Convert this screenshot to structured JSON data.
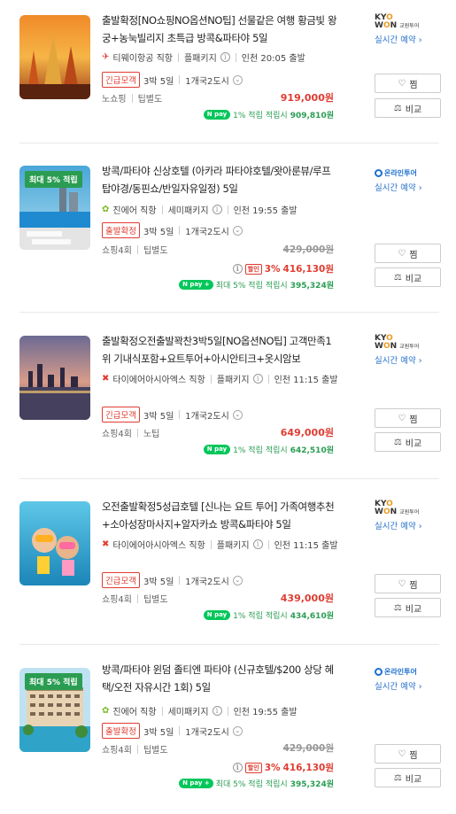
{
  "labels": {
    "wish": "찜",
    "compare": "비교",
    "realtime": "실시간 예약 ›",
    "reward_prefix": "적립시"
  },
  "products": [
    {
      "title": "출발확정[NO쇼핑NO옵션NO팁] 선물같은 여행 황금빛 왕궁+농눅빌리지 초특급 방콕&파타야 5일",
      "badge": "",
      "airline": "티웨이항공 직항",
      "airline_icon": "airplane-icon",
      "package": "플패키지",
      "departure": "인천 20:05 출발",
      "status_tag": "긴급모객",
      "duration": "3박 5일",
      "countries": "1개국2도시",
      "shopping": "노쇼핑",
      "tip": "팁별도",
      "original_price": "",
      "discount_rate": "",
      "discount_label": "",
      "price": "919,000원",
      "reward_rate": "1% 적립",
      "reward_amount": "909,810원",
      "agency": "KYOWON 교원투어"
    },
    {
      "title": "방콕/파타야 신상호텔 (아카라 파타야호텔/왓아룬뷰/루프탑야경/동핀쇼/반일자유일정) 5일",
      "badge": "최대 5% 적립",
      "airline": "진에어 직항",
      "airline_icon": "airplane-icon",
      "package": "세미패키지",
      "departure": "인천 19:55 출발",
      "status_tag": "출발확정",
      "duration": "3박 5일",
      "countries": "1개국2도시",
      "shopping": "쇼핑4회",
      "tip": "팁별도",
      "original_price": "429,000원",
      "discount_rate": "3%",
      "discount_label": "할인",
      "price": "416,130원",
      "reward_rate": "최대 5% 적립",
      "reward_amount": "395,324원",
      "agency": "온라인투어"
    },
    {
      "title": "출발확정오전출발꽉찬3박5일[NO옵션NO팁] 고객만족1위 기내식포함+요트투어+아시안티크+옷시암보",
      "badge": "",
      "airline": "타이에어아시아엑스 직항",
      "airline_icon": "airplane-icon",
      "package": "플패키지",
      "departure": "인천 11:15 출발",
      "status_tag": "긴급모객",
      "duration": "3박 5일",
      "countries": "1개국2도시",
      "shopping": "쇼핑4회",
      "tip": "노팁",
      "original_price": "",
      "discount_rate": "",
      "discount_label": "",
      "price": "649,000원",
      "reward_rate": "1% 적립",
      "reward_amount": "642,510원",
      "agency": "KYOWON 교원투어"
    },
    {
      "title": "오전출발확정5성급호텔 [신나는 요트 투어] 가족여행추천+소아성장마사지+알자카쇼 방콕&파타야 5일",
      "badge": "",
      "airline": "타이에어아시아엑스 직항",
      "airline_icon": "airplane-icon",
      "package": "플패키지",
      "departure": "인천 11:15 출발",
      "status_tag": "긴급모객",
      "duration": "3박 5일",
      "countries": "1개국2도시",
      "shopping": "쇼핑4회",
      "tip": "팁별도",
      "original_price": "",
      "discount_rate": "",
      "discount_label": "",
      "price": "439,000원",
      "reward_rate": "1% 적립",
      "reward_amount": "434,610원",
      "agency": "KYOWON 교원투어"
    },
    {
      "title": "방콕/파타야 윈덤 졸티엔 파타야 (신규호텔/$200 상당 혜택/오전 자유시간 1회) 5일",
      "badge": "최대 5% 적립",
      "airline": "진에어 직항",
      "airline_icon": "airplane-icon",
      "package": "세미패키지",
      "departure": "인천 19:55 출발",
      "status_tag": "출발확정",
      "duration": "3박 5일",
      "countries": "1개국2도시",
      "shopping": "쇼핑4회",
      "tip": "팁별도",
      "original_price": "429,000원",
      "discount_rate": "3%",
      "discount_label": "할인",
      "price": "416,130원",
      "reward_rate": "최대 5% 적립",
      "reward_amount": "395,324원",
      "agency": "온라인투어"
    }
  ],
  "colors": {
    "accent_red": "#e03c31",
    "reward_green": "#2a9d52",
    "npay_green": "#03c75a",
    "link_blue": "#2a73c9"
  }
}
